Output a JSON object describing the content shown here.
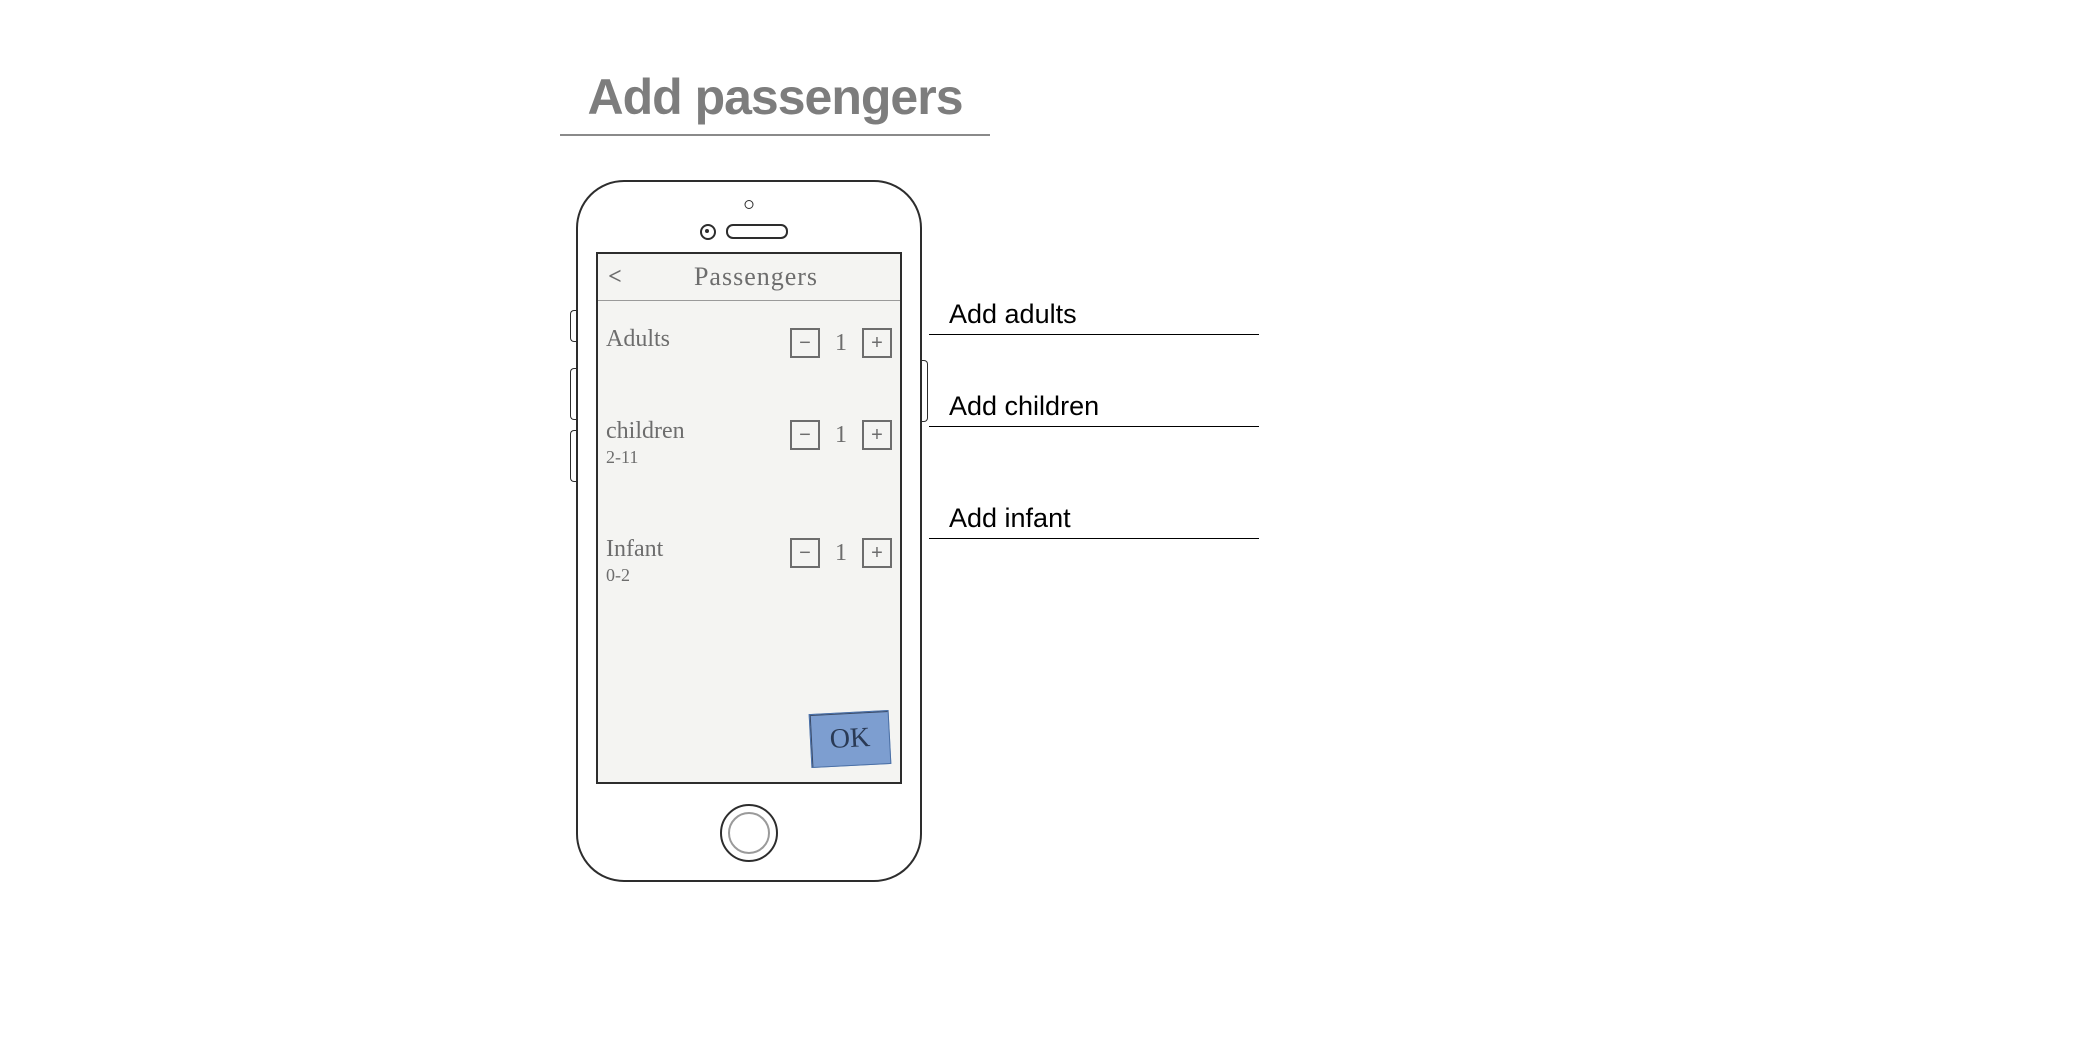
{
  "title": "Add passengers",
  "screen": {
    "back_glyph": "<",
    "header": "Passengers",
    "rows": [
      {
        "label": "Adults",
        "sub": "",
        "value": "1"
      },
      {
        "label": "children",
        "sub": "2-11",
        "value": "1"
      },
      {
        "label": "Infant",
        "sub": "0-2",
        "value": "1"
      }
    ],
    "minus_glyph": "−",
    "plus_glyph": "+",
    "confirm": "OK"
  },
  "callouts": {
    "adults": "Add adults",
    "children": "Add children",
    "infant": "Add infant"
  }
}
